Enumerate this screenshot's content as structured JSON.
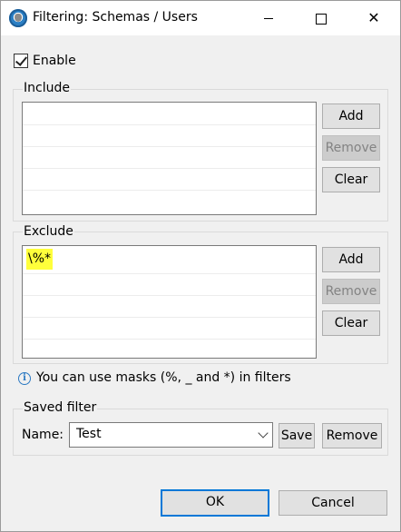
{
  "window": {
    "title": "Filtering: Schemas / Users"
  },
  "enable": {
    "label": "Enable",
    "checked": true
  },
  "include": {
    "label": "Include",
    "items": [],
    "buttons": {
      "add": "Add",
      "remove": "Remove",
      "clear": "Clear"
    }
  },
  "exclude": {
    "label": "Exclude",
    "items": [
      "\\%*"
    ],
    "buttons": {
      "add": "Add",
      "remove": "Remove",
      "clear": "Clear"
    }
  },
  "info": {
    "text": "You can use masks (%, _ and *) in filters"
  },
  "saved_filter": {
    "label": "Saved filter",
    "name_label": "Name:",
    "name_value": "Test",
    "save_label": "Save",
    "remove_label": "Remove"
  },
  "footer": {
    "ok_label": "OK",
    "cancel_label": "Cancel"
  },
  "colors": {
    "highlight": "#ffff3b",
    "default_button_border": "#0078d7",
    "info_icon": "#2b79c2"
  }
}
